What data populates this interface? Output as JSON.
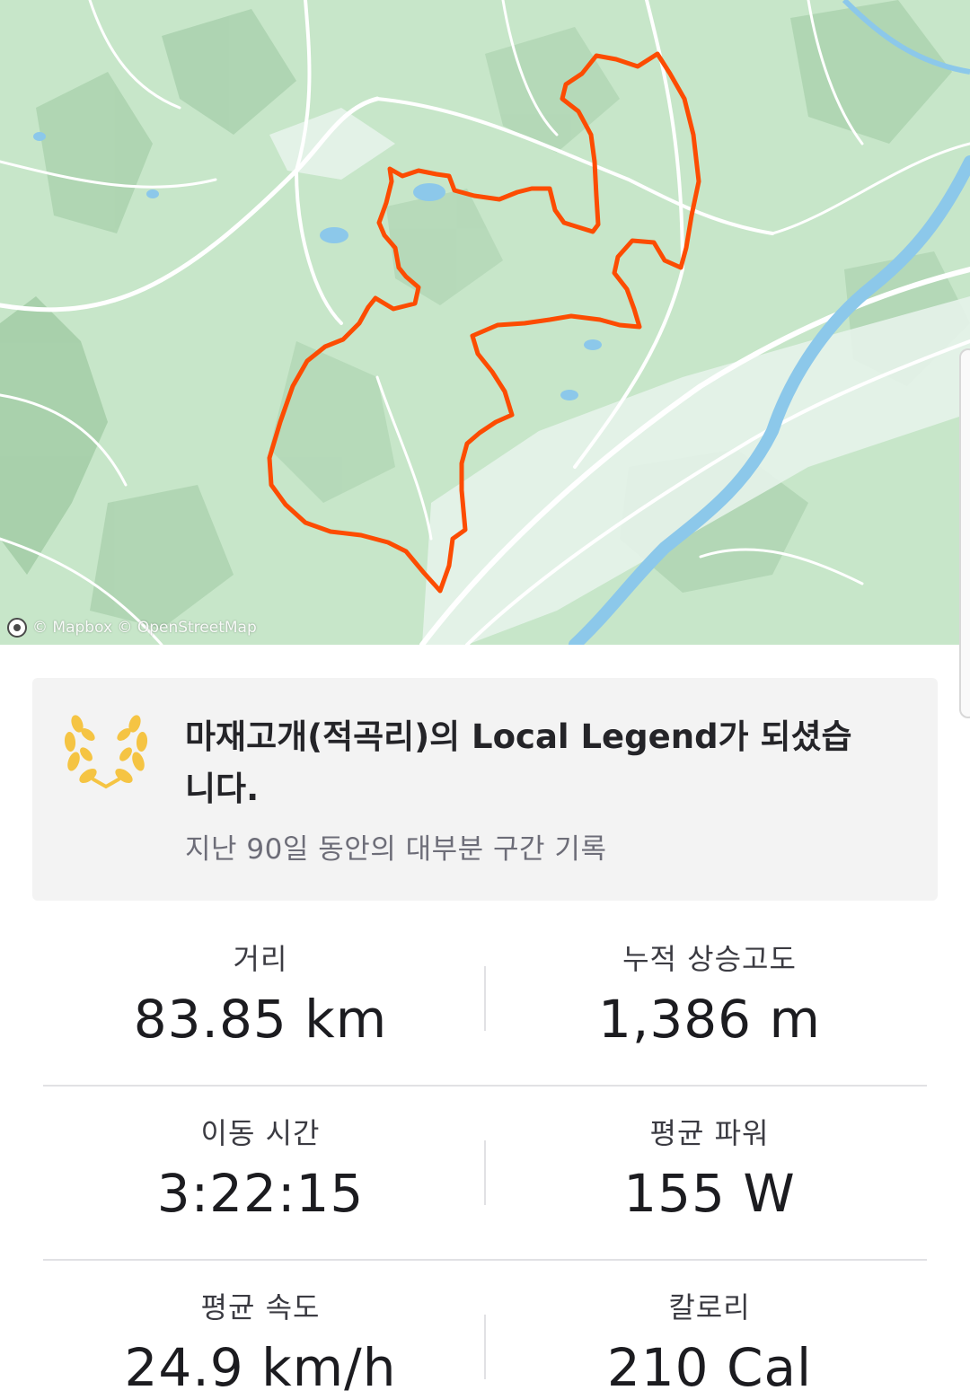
{
  "map": {
    "attribution": "© Mapbox © OpenStreetMap",
    "route_color": "#fc4c02",
    "water_color": "#8cc8ea",
    "road_color": "#ffffff",
    "terrain_color": "#c7e6c9",
    "attribution_icon": "mapbox-logo-icon"
  },
  "local_legend": {
    "title": "마재고개(적곡리)의  Local Legend가 되셨습니다.",
    "subtitle": "지난 90일 동안의 대부분 구간 기록",
    "icon": "laurel-wreath-icon",
    "icon_color": "#f5c443"
  },
  "stats": [
    {
      "label": "거리",
      "value": "83.85 km"
    },
    {
      "label": "누적 상승고도",
      "value": "1,386 m"
    },
    {
      "label": "이동 시간",
      "value": "3:22:15"
    },
    {
      "label": "평균 파워",
      "value": "155 W"
    },
    {
      "label": "평균 속도",
      "value": "24.9 km/h"
    },
    {
      "label": "칼로리",
      "value": "210 Cal"
    }
  ]
}
